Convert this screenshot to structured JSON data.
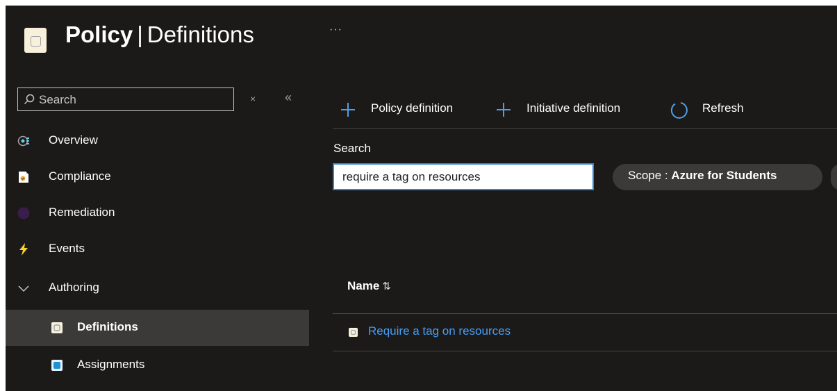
{
  "header": {
    "title_bold": "Policy",
    "title_sep": "|",
    "title_rest": "Definitions",
    "more": "···"
  },
  "sidebar": {
    "search_placeholder": "Search",
    "clear_glyph": "×",
    "collapse_glyph": "«",
    "items": [
      {
        "label": "Overview",
        "icon": "overview-icon"
      },
      {
        "label": "Compliance",
        "icon": "compliance-icon"
      },
      {
        "label": "Remediation",
        "icon": "remediation-icon"
      },
      {
        "label": "Events",
        "icon": "lightning-icon"
      },
      {
        "label": "Authoring",
        "icon": "chevron-down-icon"
      },
      {
        "label": "Definitions",
        "icon": "definitions-icon",
        "selected": true
      },
      {
        "label": "Assignments",
        "icon": "assignments-icon"
      }
    ]
  },
  "toolbar": {
    "policy_definition": "Policy definition",
    "initiative_definition": "Initiative definition",
    "refresh": "Refresh"
  },
  "filters": {
    "search_label": "Search",
    "search_value": "require a tag on resources",
    "scope_label": "Scope : ",
    "scope_value": "Azure for Students"
  },
  "table": {
    "columns": [
      {
        "label": "Name",
        "sort_glyph": "⇅"
      }
    ],
    "rows": [
      {
        "name": "Require a tag on resources"
      }
    ]
  },
  "colors": {
    "background": "#1b1a19",
    "accent": "#2b88d8",
    "link": "#479ef5",
    "selected": "#3b3a39"
  }
}
